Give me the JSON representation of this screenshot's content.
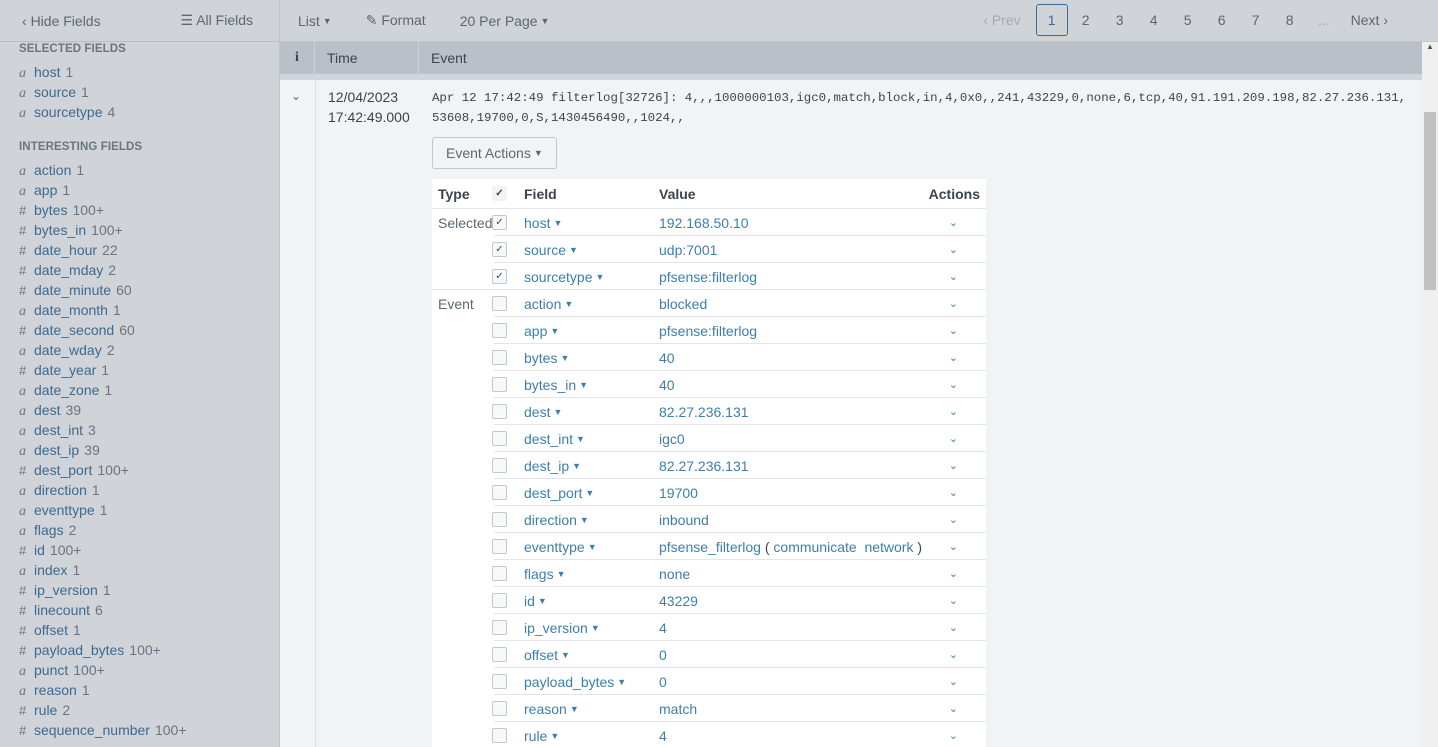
{
  "sidebar": {
    "hide_fields": "Hide Fields",
    "all_fields": "All Fields",
    "selected_title": "SELECTED FIELDS",
    "selected": [
      {
        "type": "a",
        "name": "host",
        "count": "1"
      },
      {
        "type": "a",
        "name": "source",
        "count": "1"
      },
      {
        "type": "a",
        "name": "sourcetype",
        "count": "4"
      }
    ],
    "interesting_title": "INTERESTING FIELDS",
    "interesting": [
      {
        "type": "a",
        "name": "action",
        "count": "1"
      },
      {
        "type": "a",
        "name": "app",
        "count": "1"
      },
      {
        "type": "#",
        "name": "bytes",
        "count": "100+"
      },
      {
        "type": "#",
        "name": "bytes_in",
        "count": "100+"
      },
      {
        "type": "#",
        "name": "date_hour",
        "count": "22"
      },
      {
        "type": "#",
        "name": "date_mday",
        "count": "2"
      },
      {
        "type": "#",
        "name": "date_minute",
        "count": "60"
      },
      {
        "type": "a",
        "name": "date_month",
        "count": "1"
      },
      {
        "type": "#",
        "name": "date_second",
        "count": "60"
      },
      {
        "type": "a",
        "name": "date_wday",
        "count": "2"
      },
      {
        "type": "#",
        "name": "date_year",
        "count": "1"
      },
      {
        "type": "a",
        "name": "date_zone",
        "count": "1"
      },
      {
        "type": "a",
        "name": "dest",
        "count": "39"
      },
      {
        "type": "a",
        "name": "dest_int",
        "count": "3"
      },
      {
        "type": "a",
        "name": "dest_ip",
        "count": "39"
      },
      {
        "type": "#",
        "name": "dest_port",
        "count": "100+"
      },
      {
        "type": "a",
        "name": "direction",
        "count": "1"
      },
      {
        "type": "a",
        "name": "eventtype",
        "count": "1"
      },
      {
        "type": "a",
        "name": "flags",
        "count": "2"
      },
      {
        "type": "#",
        "name": "id",
        "count": "100+"
      },
      {
        "type": "a",
        "name": "index",
        "count": "1"
      },
      {
        "type": "#",
        "name": "ip_version",
        "count": "1"
      },
      {
        "type": "#",
        "name": "linecount",
        "count": "6"
      },
      {
        "type": "#",
        "name": "offset",
        "count": "1"
      },
      {
        "type": "#",
        "name": "payload_bytes",
        "count": "100+"
      },
      {
        "type": "a",
        "name": "punct",
        "count": "100+"
      },
      {
        "type": "a",
        "name": "reason",
        "count": "1"
      },
      {
        "type": "#",
        "name": "rule",
        "count": "2"
      },
      {
        "type": "#",
        "name": "sequence_number",
        "count": "100+"
      }
    ]
  },
  "toolbar": {
    "list": "List",
    "format": "Format",
    "per_page": "20 Per Page"
  },
  "pager": {
    "prev": "Prev",
    "pages": [
      "1",
      "2",
      "3",
      "4",
      "5",
      "6",
      "7",
      "8"
    ],
    "current": "1",
    "ellipsis": "...",
    "next": "Next"
  },
  "table_header": {
    "info": "i",
    "time": "Time",
    "event": "Event"
  },
  "event": {
    "date": "12/04/2023",
    "time": "17:42:49.000",
    "raw": "Apr 12 17:42:49 filterlog[32726]: 4,,,1000000103,igc0,match,block,in,4,0x0,,241,43229,0,none,6,tcp,40,91.191.209.198,82.27.236.131,53608,19700,0,S,1430456490,,1024,,",
    "actions_label": "Event Actions"
  },
  "fields_table": {
    "headers": {
      "type": "Type",
      "field": "Field",
      "value": "Value",
      "actions": "Actions"
    },
    "rows": [
      {
        "type": "Selected",
        "checked": true,
        "field": "host",
        "value": "192.168.50.10"
      },
      {
        "type": "",
        "checked": true,
        "field": "source",
        "value": "udp:7001"
      },
      {
        "type": "",
        "checked": true,
        "field": "sourcetype",
        "value": "pfsense:filterlog",
        "grpend": true
      },
      {
        "type": "Event",
        "checked": false,
        "field": "action",
        "value": "blocked"
      },
      {
        "type": "",
        "checked": false,
        "field": "app",
        "value": "pfsense:filterlog"
      },
      {
        "type": "",
        "checked": false,
        "field": "bytes",
        "value": "40"
      },
      {
        "type": "",
        "checked": false,
        "field": "bytes_in",
        "value": "40"
      },
      {
        "type": "",
        "checked": false,
        "field": "dest",
        "value": "82.27.236.131"
      },
      {
        "type": "",
        "checked": false,
        "field": "dest_int",
        "value": "igc0"
      },
      {
        "type": "",
        "checked": false,
        "field": "dest_ip",
        "value": "82.27.236.131"
      },
      {
        "type": "",
        "checked": false,
        "field": "dest_port",
        "value": "19700"
      },
      {
        "type": "",
        "checked": false,
        "field": "direction",
        "value": "inbound"
      },
      {
        "type": "",
        "checked": false,
        "field": "eventtype",
        "value": "pfsense_filterlog",
        "tags": "communicate  network"
      },
      {
        "type": "",
        "checked": false,
        "field": "flags",
        "value": "none"
      },
      {
        "type": "",
        "checked": false,
        "field": "id",
        "value": "43229"
      },
      {
        "type": "",
        "checked": false,
        "field": "ip_version",
        "value": "4"
      },
      {
        "type": "",
        "checked": false,
        "field": "offset",
        "value": "0"
      },
      {
        "type": "",
        "checked": false,
        "field": "payload_bytes",
        "value": "0"
      },
      {
        "type": "",
        "checked": false,
        "field": "reason",
        "value": "match"
      },
      {
        "type": "",
        "checked": false,
        "field": "rule",
        "value": "4"
      }
    ]
  }
}
